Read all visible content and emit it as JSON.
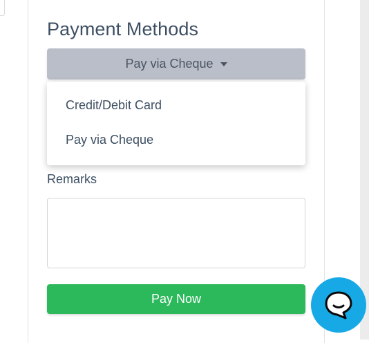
{
  "payment": {
    "title": "Payment Methods",
    "selected_method": "Pay via Cheque",
    "options": [
      "Credit/Debit Card",
      "Pay via Cheque"
    ]
  },
  "remarks": {
    "label": "Remarks",
    "value": ""
  },
  "actions": {
    "pay_label": "Pay Now"
  },
  "icons": {
    "dropdown_caret": "caret-down-icon",
    "resize_grip": "resize-grip-icon",
    "chat": "chat-bubble-icon"
  },
  "colors": {
    "title_text": "#3d4f63",
    "dropdown_bg": "#b9bec8",
    "pay_button_bg": "#2cb95c",
    "chat_launcher_bg": "#17a9e6"
  }
}
